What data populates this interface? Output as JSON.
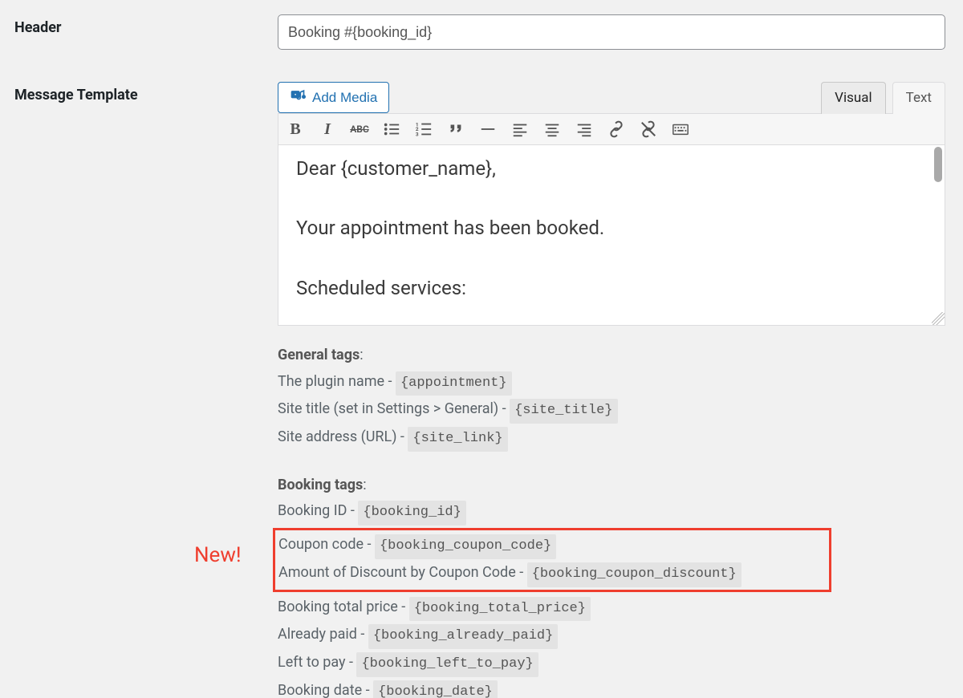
{
  "header": {
    "label": "Header",
    "value": "Booking #{booking_id}"
  },
  "message": {
    "label": "Message Template",
    "add_media": "Add Media",
    "tabs": {
      "visual": "Visual",
      "text": "Text"
    },
    "toolbar": {
      "bold": "B",
      "italic": "I",
      "strike": "ABC"
    },
    "body_lines": [
      "Dear {customer_name},",
      "Your appointment has been booked.",
      "Scheduled services:"
    ]
  },
  "callout": {
    "new_label": "New!"
  },
  "tags": {
    "general": {
      "title": "General tags",
      "items": [
        {
          "label": "The plugin name - ",
          "code": "{appointment}"
        },
        {
          "label": "Site title (set in Settings > General) - ",
          "code": "{site_title}"
        },
        {
          "label": "Site address (URL) - ",
          "code": "{site_link}"
        }
      ]
    },
    "booking": {
      "title": "Booking tags",
      "items_before": [
        {
          "label": "Booking ID - ",
          "code": "{booking_id}"
        }
      ],
      "items_highlight": [
        {
          "label": "Coupon code - ",
          "code": "{booking_coupon_code}"
        },
        {
          "label": "Amount of Discount by Coupon Code - ",
          "code": "{booking_coupon_discount}"
        }
      ],
      "items_after": [
        {
          "label": "Booking total price - ",
          "code": "{booking_total_price}"
        },
        {
          "label": "Already paid - ",
          "code": "{booking_already_paid}"
        },
        {
          "label": "Left to pay - ",
          "code": "{booking_left_to_pay}"
        },
        {
          "label": "Booking date - ",
          "code": "{booking_date}"
        }
      ]
    }
  }
}
